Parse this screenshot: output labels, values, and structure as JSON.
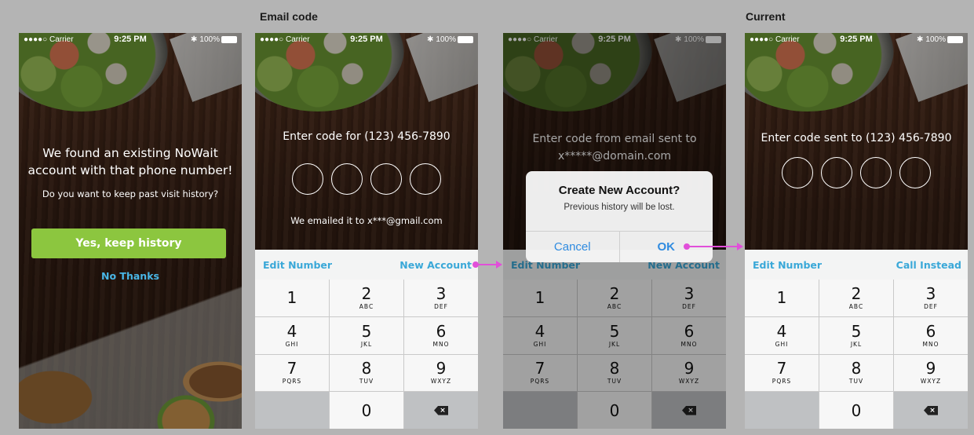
{
  "labels": {
    "email_code": "Email code",
    "current": "Current"
  },
  "status": {
    "carrier": "●●●●○ Carrier",
    "time": "9:25 PM",
    "battery": "100%",
    "bt": "✱"
  },
  "screen1": {
    "line1": "We found an existing NoWait",
    "line2": "account with that phone number!",
    "question": "Do you want to keep past visit history?",
    "primary": "Yes, keep history",
    "secondary": "No Thanks"
  },
  "screen2": {
    "prompt": "Enter code  for (123) 456-7890",
    "note": "We emailed it to x***@gmail.com",
    "left_action": "Edit Number",
    "right_action": "New Account"
  },
  "screen3": {
    "prompt1": "Enter code from email sent to",
    "prompt2": "x*****@domain.com",
    "left_action": "Edit Number",
    "right_action": "New Account",
    "dialog": {
      "title": "Create New Account?",
      "message": "Previous history will be lost.",
      "cancel": "Cancel",
      "ok": "OK"
    }
  },
  "screen4": {
    "prompt": "Enter code sent to (123) 456-7890",
    "left_action": "Edit Number",
    "right_action": "Call Instead"
  },
  "keypad": [
    {
      "num": "1",
      "letters": ""
    },
    {
      "num": "2",
      "letters": "ABC"
    },
    {
      "num": "3",
      "letters": "DEF"
    },
    {
      "num": "4",
      "letters": "GHI"
    },
    {
      "num": "5",
      "letters": "JKL"
    },
    {
      "num": "6",
      "letters": "MNO"
    },
    {
      "num": "7",
      "letters": "PQRS"
    },
    {
      "num": "8",
      "letters": "TUV"
    },
    {
      "num": "9",
      "letters": "WXYZ"
    },
    {
      "num": "",
      "letters": ""
    },
    {
      "num": "0",
      "letters": ""
    },
    {
      "num": "delete-icon",
      "letters": ""
    }
  ],
  "colors": {
    "accent_green": "#8cc63f",
    "link_blue": "#3aa8d8",
    "annotation": "#e14fd9"
  }
}
